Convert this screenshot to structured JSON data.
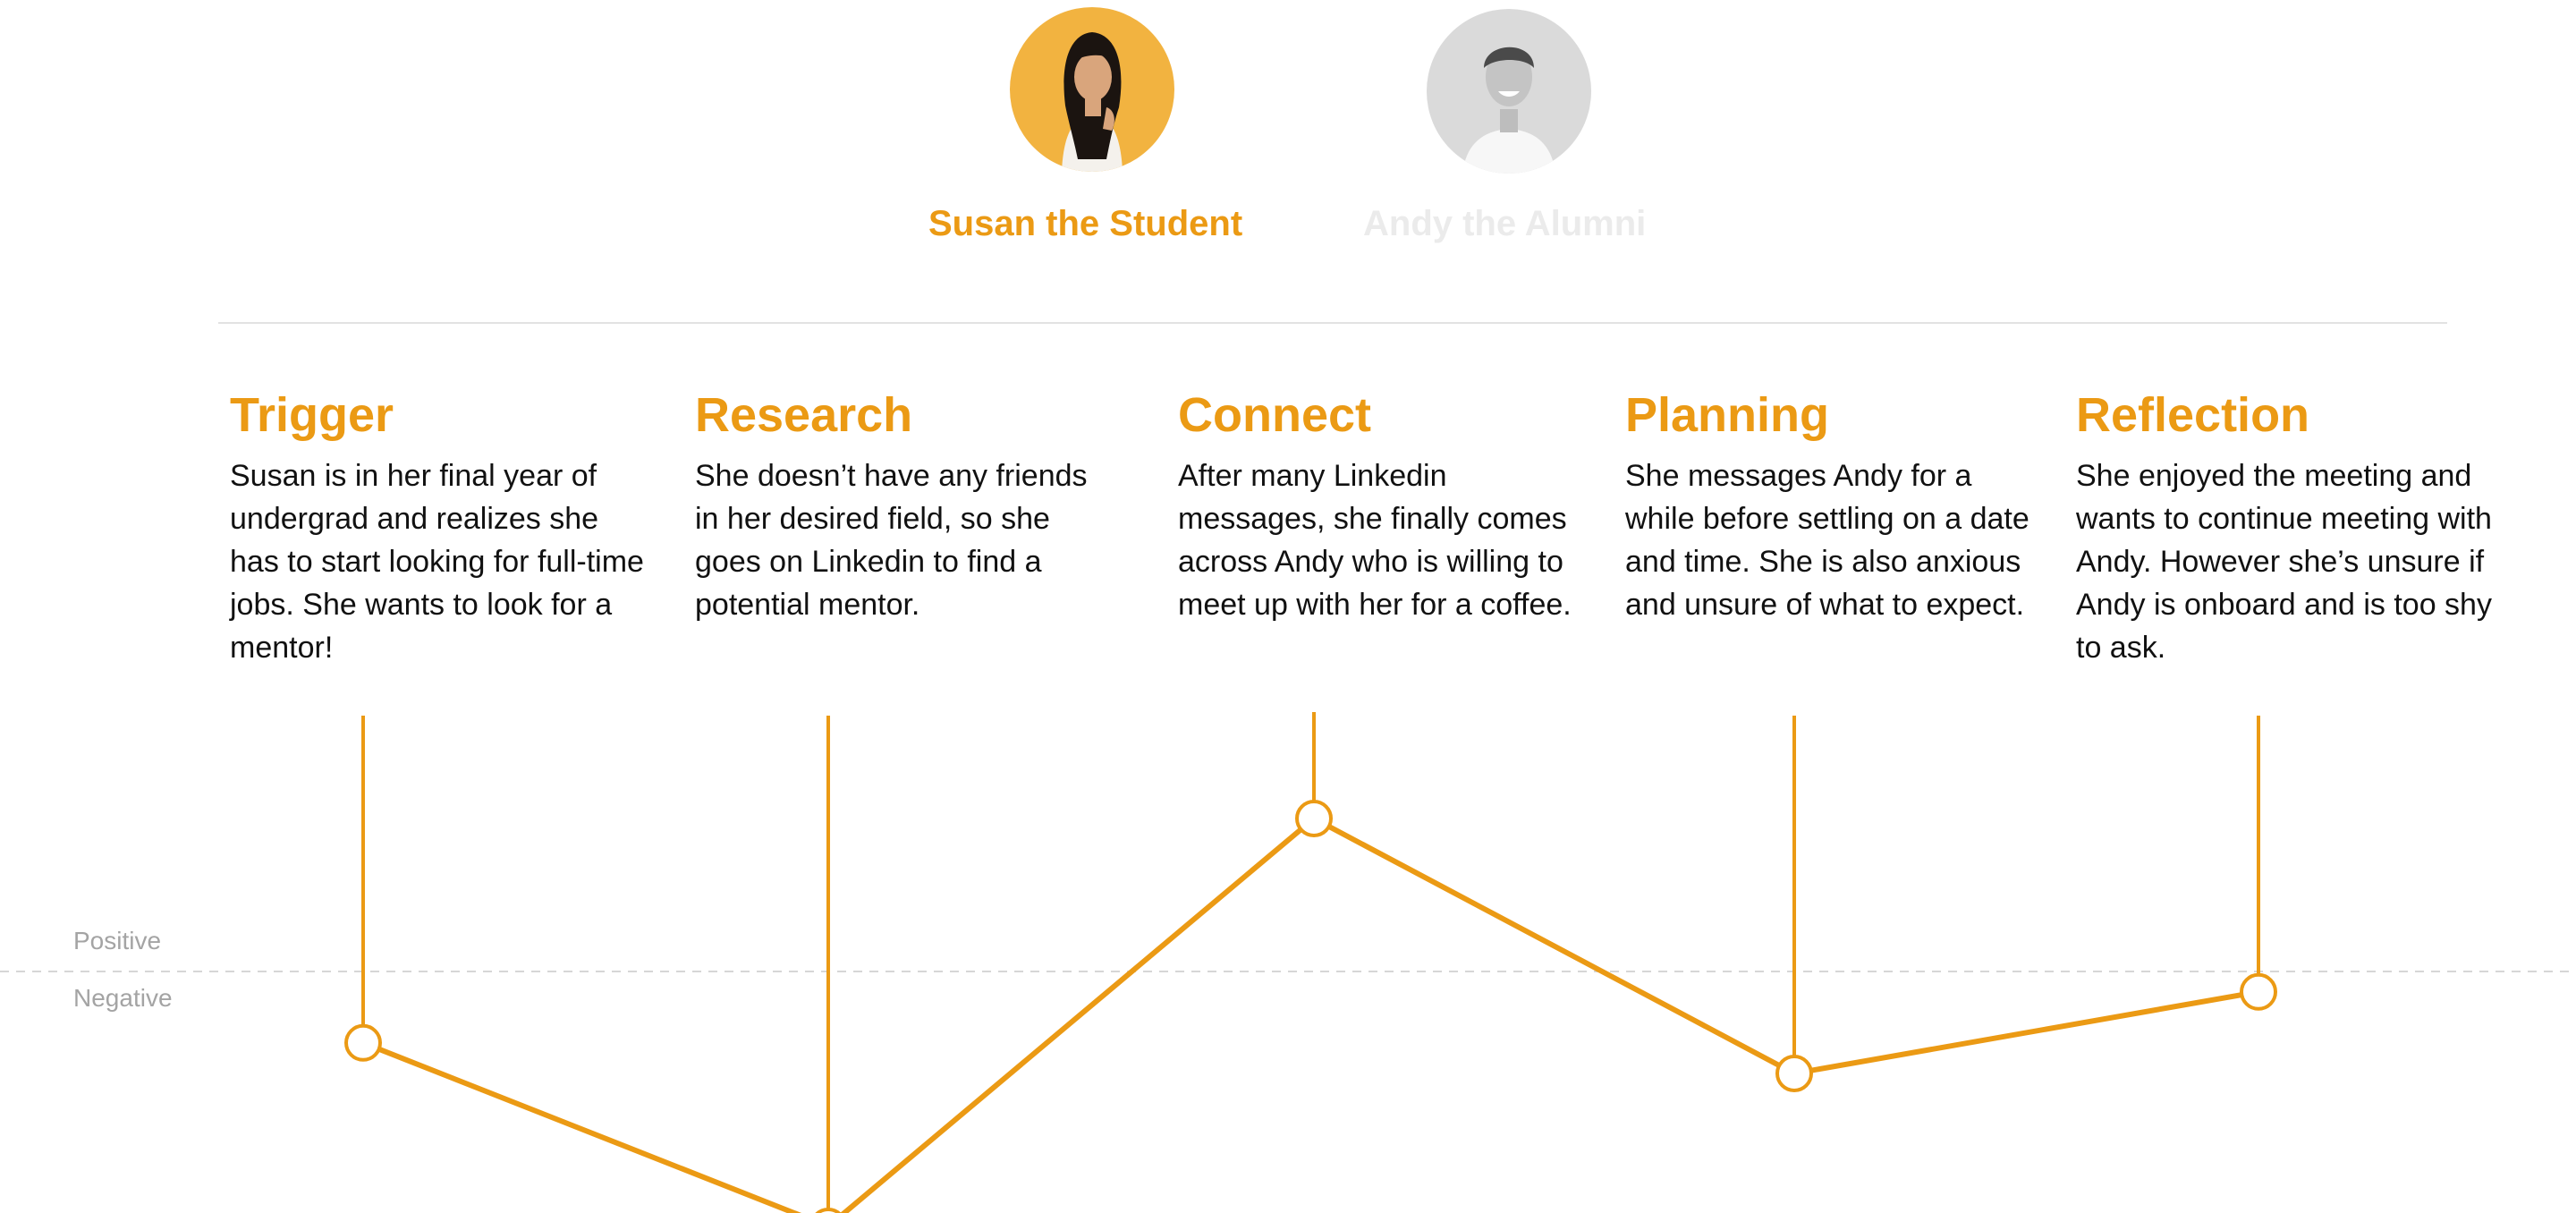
{
  "personas": [
    {
      "name": "Susan the Student",
      "active": true
    },
    {
      "name": "Andy the Alumni",
      "active": false
    }
  ],
  "stages": [
    {
      "title": "Trigger",
      "description": "Susan is in her final year of undergrad and realizes she has to start looking for full-time jobs. She wants to look for a mentor!"
    },
    {
      "title": "Research",
      "description": "She doesn’t have any friends in her desired field, so she goes on Linkedin to find a potential mentor."
    },
    {
      "title": "Connect",
      "description": "After many Linkedin messages, she finally comes across Andy who is willing to meet up with her for a coffee."
    },
    {
      "title": "Planning",
      "description": "She messages Andy for a while before settling on a date and time. She is also anxious and unsure of what to expect."
    },
    {
      "title": "Reflection",
      "description": "She enjoyed the meeting and wants to continue meeting with Andy. However she’s unsure if Andy is onboard and is too shy to ask."
    }
  ],
  "axis": {
    "positive_label": "Positive",
    "negative_label": "Negative"
  },
  "chart_data": {
    "type": "line",
    "categories": [
      "Trigger",
      "Research",
      "Connect",
      "Planning",
      "Reflection"
    ],
    "values": [
      -0.35,
      -1.25,
      0.75,
      -0.5,
      -0.1
    ],
    "ylim": [
      -1.4,
      1.0
    ],
    "grid": false
  },
  "colors": {
    "accent": "#eb9a14",
    "inactive": "#ebebeb",
    "divider": "#e2e2e2",
    "axis_text": "#a4a4a4",
    "body_text": "#111111"
  }
}
